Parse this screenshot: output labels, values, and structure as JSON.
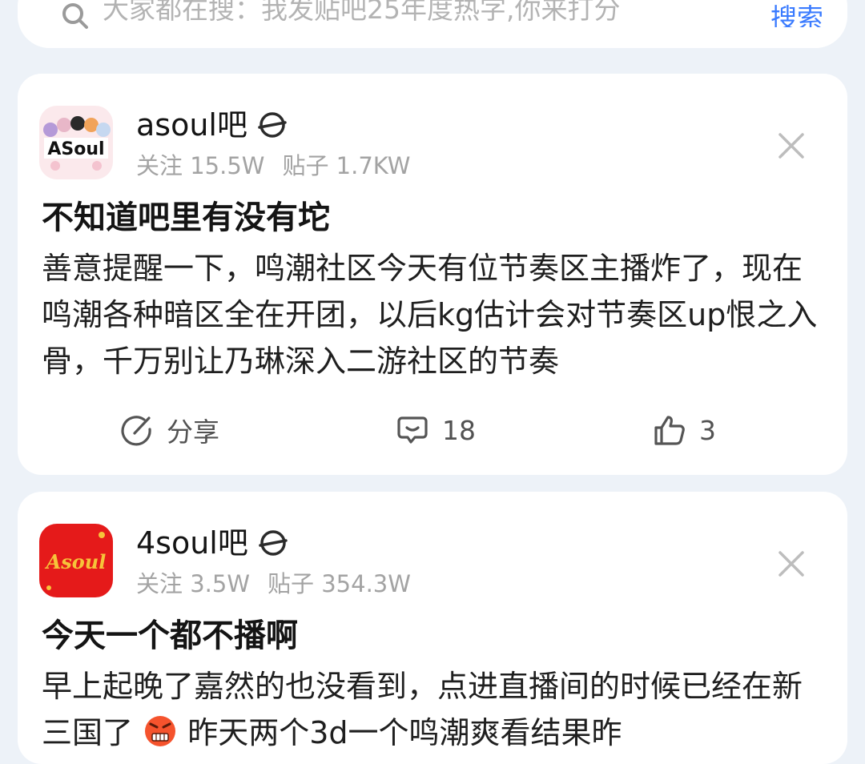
{
  "search": {
    "placeholder": "大家都在搜：我发贴吧25年度热字,你来打分",
    "button_label": "搜索"
  },
  "posts": [
    {
      "forum_name": "asoul吧",
      "followers": "关注 15.5W",
      "post_count": "贴子 1.7KW",
      "avatar_text": "ASoul",
      "title": "不知道吧里有没有坨",
      "body": "善意提醒一下，鸣潮社区今天有位节奏区主播炸了，现在鸣潮各种暗区全在开团，以后kg估计会对节奏区up恨之入骨，千万别让乃琳深入二游社区的节奏",
      "share_label": "分享",
      "comment_count": "18",
      "like_count": "3"
    },
    {
      "forum_name": "4soul吧",
      "followers": "关注 3.5W",
      "post_count": "贴子 354.3W",
      "avatar_text": "Asoul",
      "title": "今天一个都不播啊",
      "body_part1": "早上起晚了嘉然的也没看到，点进直播间的时候已经在新三国了",
      "body_part2": "昨天两个3d一个鸣潮爽看结果昨"
    }
  ],
  "colors": {
    "accent": "#3a7bff",
    "page_bg": "#edf2f8",
    "card_bg": "#ffffff",
    "muted_text": "#a3a3a3",
    "avatar2_red": "#e51a1a"
  },
  "icons": [
    "search-icon",
    "forum-level-icon",
    "close-icon",
    "share-icon",
    "comment-icon",
    "like-icon",
    "angry-emoji-icon"
  ]
}
